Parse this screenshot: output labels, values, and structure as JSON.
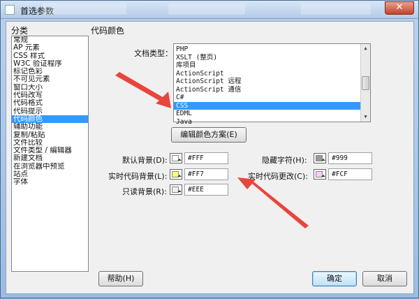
{
  "window": {
    "title": "首选参数",
    "close_glyph": "✕"
  },
  "categories": {
    "header": "分类",
    "items": [
      "常规",
      "AP 元素",
      "CSS 样式",
      "W3C 验证程序",
      "标记色彩",
      "不可见元素",
      "窗口大小",
      "代码改写",
      "代码格式",
      "代码提示",
      "代码颜色",
      "辅助功能",
      "复制/粘贴",
      "文件比较",
      "文件类型 / 编辑器",
      "新建文档",
      "在浏览器中预览",
      "站点",
      "字体"
    ],
    "selected_index": 10
  },
  "panel": {
    "title": "代码颜色",
    "doc_type_label": "文档类型：",
    "doc_types": [
      "PHP",
      "XSLT (整页)",
      "库项目",
      "ActionScript",
      "ActionScript 远程",
      "ActionScript 通信",
      "C#",
      "CSS",
      "EDML",
      "Java"
    ],
    "selected_doc_type_index": 7,
    "edit_scheme_button": "编辑颜色方案(E)"
  },
  "colors": {
    "default_bg": {
      "label": "默认背景(D):",
      "value": "#FFF",
      "swatch": "#ffffff"
    },
    "hidden_chars": {
      "label": "隐藏字符(H):",
      "value": "#999",
      "swatch": "#999999"
    },
    "live_code_bg": {
      "label": "实时代码背景(L):",
      "value": "#FF7",
      "swatch": "#ffff77"
    },
    "live_code_changes": {
      "label": "实时代码更改(C):",
      "value": "#FCF",
      "swatch": "#ffccff"
    },
    "readonly_bg": {
      "label": "只读背景(R):",
      "value": "#EEE",
      "swatch": "#eeeeee"
    }
  },
  "buttons": {
    "help": "帮助(H)",
    "ok": "确定",
    "cancel": "取消"
  },
  "accent": {
    "selection": "#3399ff",
    "annotation_arrow": "#e8453c"
  }
}
